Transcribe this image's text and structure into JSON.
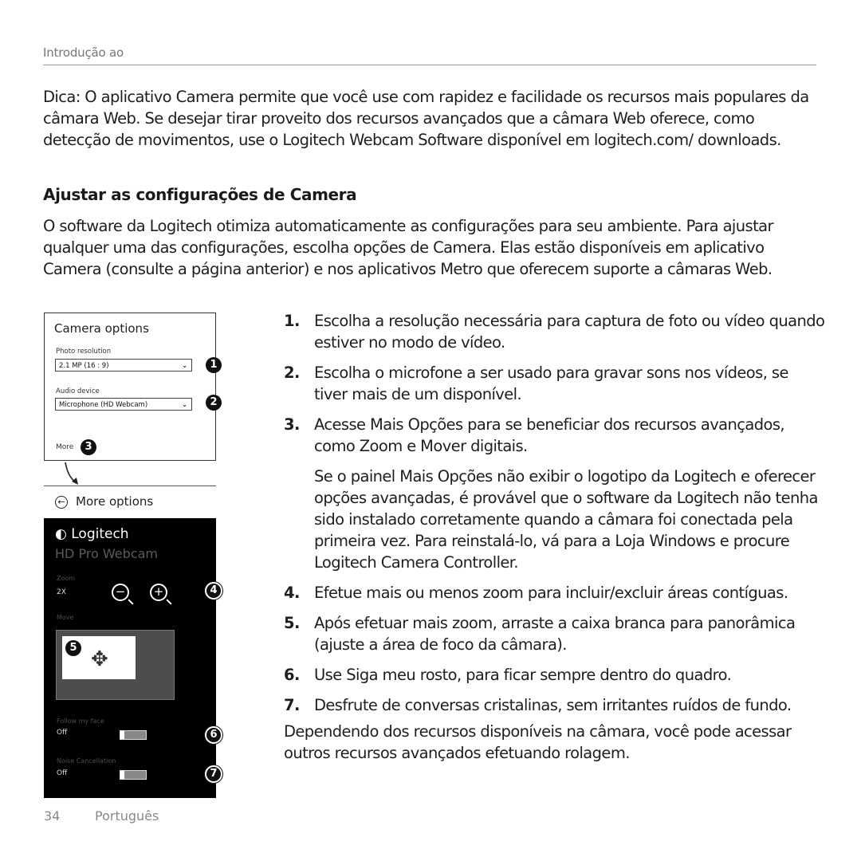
{
  "header": {
    "section": "Introdução ao"
  },
  "tip": "Dica: O aplicativo Camera permite que você use com rapidez e facilidade os recursos mais populares da câmara Web. Se desejar tirar proveito dos recursos avançados que a câmara Web oferece, como detecção de movimentos, use o Logitech Webcam Software disponível em logitech.com/ downloads.",
  "section_title": "Ajustar as configurações de Camera",
  "intro": "O software da Logitech otimiza automaticamente as configurações para seu ambiente. Para ajustar qualquer uma das configurações, escolha opções de Camera. Elas estão disponíveis em aplicativo Camera (consulte a página anterior) e nos aplicativos Metro que oferecem suporte a câmaras Web.",
  "camera_options": {
    "title": "Camera options",
    "photo_resolution_label": "Photo resolution",
    "photo_resolution_value": "2.1 MP (16 : 9)",
    "audio_device_label": "Audio device",
    "audio_device_value": "Microphone (HD Webcam)",
    "more_label": "More",
    "chevron": "⌄"
  },
  "more_options": {
    "back_icon": "←",
    "title": "More options",
    "brand": "Logitech",
    "model": "HD Pro Webcam",
    "zoom_label": "Zoom",
    "zoom_value": "2X",
    "zoom_out": "−",
    "zoom_in": "+",
    "move_label": "Move",
    "move_icon": "✥",
    "follow_face_label": "Follow my face",
    "follow_face_value": "Off",
    "noise_label": "Noise Cancellation",
    "noise_value": "Off"
  },
  "callouts": [
    "1",
    "2",
    "3",
    "4",
    "5",
    "6",
    "7"
  ],
  "steps": [
    {
      "num": "1.",
      "text": "Escolha a resolução necessária para captura de foto ou vídeo quando estiver no modo de vídeo."
    },
    {
      "num": "2.",
      "text": "Escolha o microfone a ser usado para gravar sons nos vídeos, se tiver mais de um disponível."
    },
    {
      "num": "3.",
      "text": "Acesse Mais Opções para se beneficiar dos recursos avançados, como Zoom e Mover digitais.",
      "note": "Se o painel Mais Opções não exibir o logotipo da Logitech e oferecer opções avançadas, é provável que o software da Logitech não tenha sido instalado corretamente quando a câmara foi conectada pela primeira vez. Para reinstalá-lo, vá para a Loja Windows e procure Logitech Camera Controller."
    },
    {
      "num": "4.",
      "text": "Efetue mais ou menos zoom para incluir/excluir áreas contíguas."
    },
    {
      "num": "5.",
      "text": "Após efetuar mais zoom, arraste a caixa branca para panorâmica (ajuste a área de foco da câmara)."
    },
    {
      "num": "6.",
      "text": "Use Siga meu rosto, para ficar sempre dentro do quadro."
    },
    {
      "num": "7.",
      "text": "Desfrute de conversas cristalinas, sem irritantes ruídos de fundo."
    }
  ],
  "closing": "Dependendo dos recursos disponíveis na câmara, você pode acessar outros recursos avançados efetuando rolagem.",
  "footer": {
    "page_number": "34",
    "language": "Português"
  }
}
